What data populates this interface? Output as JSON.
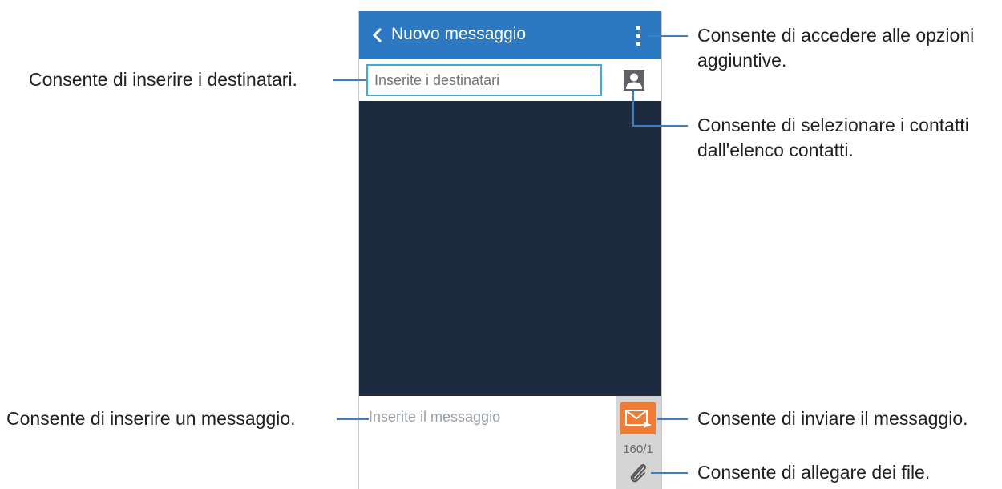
{
  "appbar": {
    "title": "Nuovo messaggio",
    "back_icon": "chevron-left-icon",
    "menu_icon": "more-vert-icon"
  },
  "recipients": {
    "placeholder": "Inserite i destinatari",
    "contact_icon": "contact-person-icon"
  },
  "composer": {
    "placeholder": "Inserite il messaggio",
    "send_icon": "send-envelope-icon",
    "counter": "160/1",
    "attach_icon": "paperclip-icon"
  },
  "callouts": {
    "menu": [
      "Consente di accedere alle opzioni",
      "aggiuntive."
    ],
    "recipients": "Consente di inserire i destinatari.",
    "contacts": [
      "Consente di selezionare i contatti",
      "dall'elenco contatti."
    ],
    "message": "Consente di inserire un messaggio.",
    "send": "Consente di inviare il messaggio.",
    "attach": "Consente di allegare dei file."
  },
  "colors": {
    "appbar": "#2c79c2",
    "content_bg": "#1e2a40",
    "input_border": "#42a7d9",
    "send_button": "#ed7d35",
    "callout_line": "#3b7fc4"
  }
}
